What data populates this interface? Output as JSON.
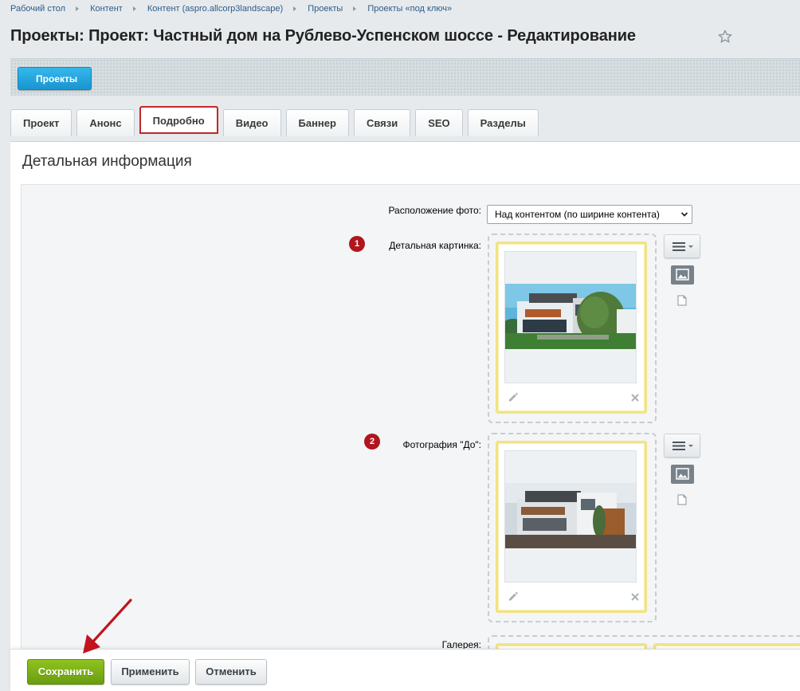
{
  "breadcrumb": [
    "Рабочий стол",
    "Контент",
    "Контент (aspro.allcorp3landscape)",
    "Проекты",
    "Проекты «под ключ»"
  ],
  "title": "Проекты: Проект: Частный дом на Рублево-Успенском шоссе - Редактирование",
  "toolbar": {
    "back_label": "Проекты"
  },
  "tabs": [
    {
      "label": "Проект"
    },
    {
      "label": "Анонс"
    },
    {
      "label": "Подробно",
      "active": true
    },
    {
      "label": "Видео"
    },
    {
      "label": "Баннер"
    },
    {
      "label": "Связи"
    },
    {
      "label": "SEO"
    },
    {
      "label": "Разделы"
    }
  ],
  "section": {
    "title": "Детальная информация"
  },
  "form": {
    "photo_position": {
      "label": "Расположение фото:",
      "value": "Над контентом (по ширине контента)"
    },
    "detail_picture": {
      "badge": "1",
      "label": "Детальная картинка:"
    },
    "before_photo": {
      "badge": "2",
      "label": "Фотография \"До\":"
    },
    "gallery": {
      "label": "Галерея:"
    }
  },
  "footer": {
    "save_label": "Сохранить",
    "apply_label": "Применить",
    "cancel_label": "Отменить"
  },
  "colors": {
    "accent_blue": "#1a95cf",
    "save_green": "#7bb01a",
    "badge_red": "#b0161d",
    "active_tab_border": "#c1272d",
    "frame_yellow": "#f1e385"
  }
}
